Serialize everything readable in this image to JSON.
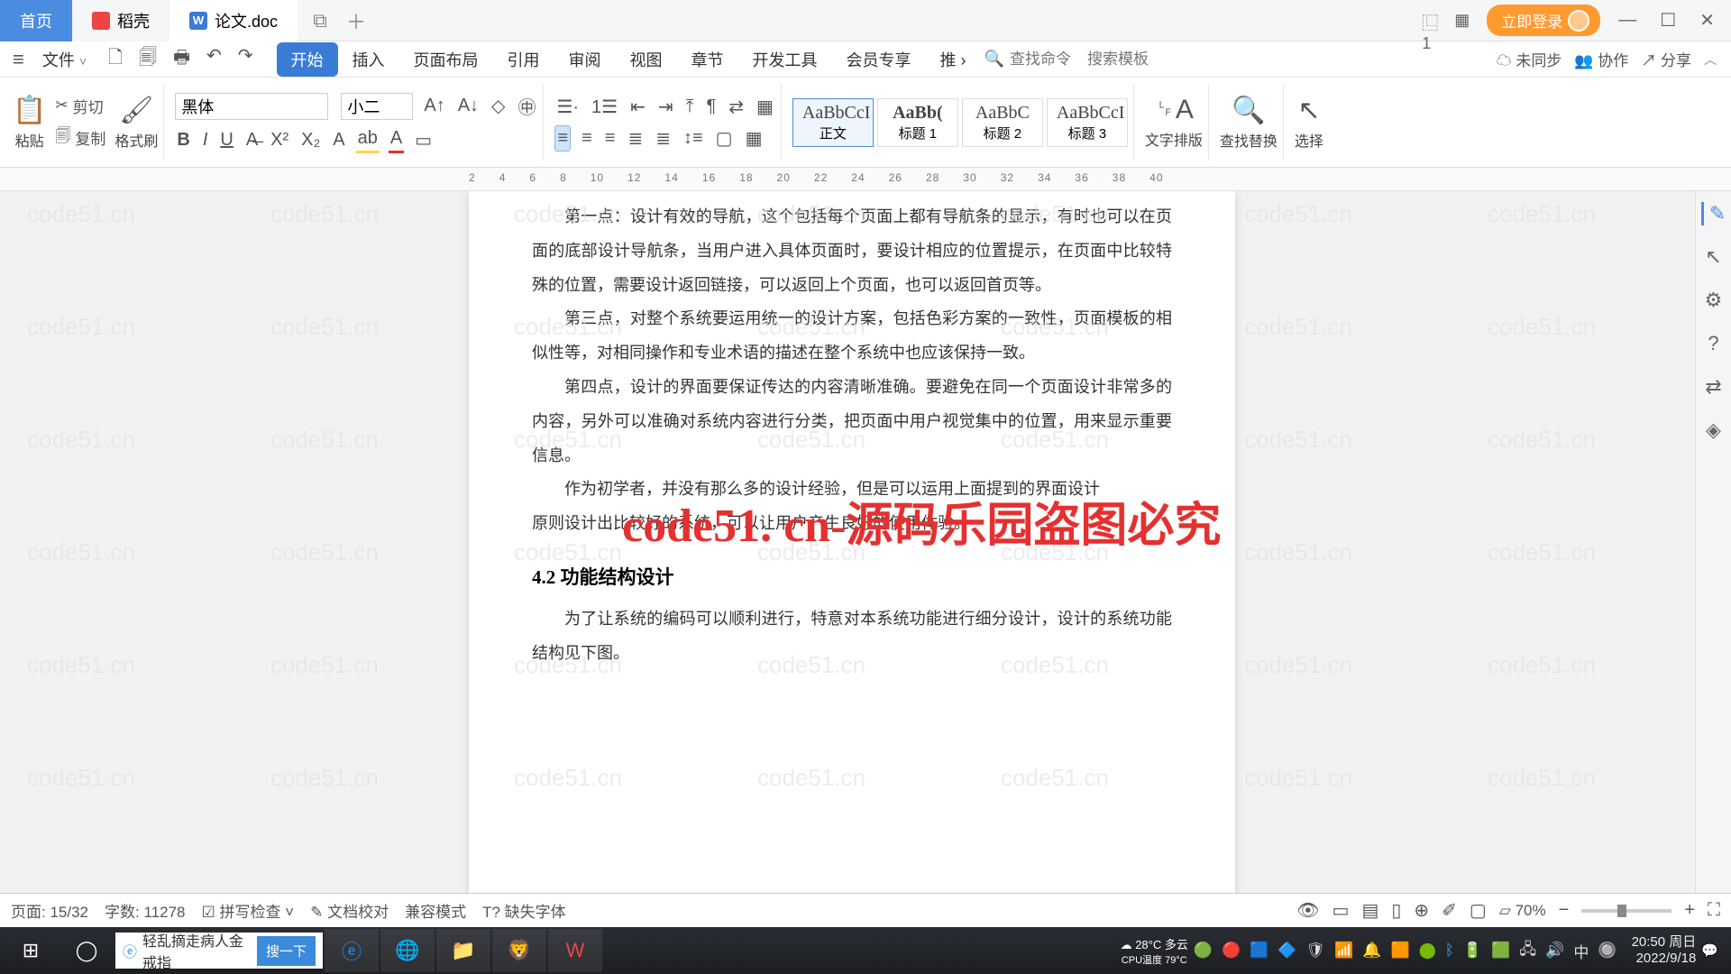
{
  "tabs": {
    "home": "首页",
    "docao": "稻壳",
    "doc": "论文.doc"
  },
  "title_right": {
    "login": "立即登录"
  },
  "menu": {
    "file": "文件",
    "ribbon": [
      "开始",
      "插入",
      "页面布局",
      "引用",
      "审阅",
      "视图",
      "章节",
      "开发工具",
      "会员专享",
      "推"
    ],
    "search_ph": "查找命令",
    "template_ph": "搜索模板",
    "unsync": "未同步",
    "collab": "协作",
    "share": "分享"
  },
  "ribbon": {
    "paste": "粘贴",
    "cut": "剪切",
    "copy": "复制",
    "fmt": "格式刷",
    "font": "黑体",
    "size": "小二",
    "styles": [
      {
        "prev": "AaBbCcI",
        "lbl": "正文"
      },
      {
        "prev": "AaBb(",
        "lbl": "标题 1"
      },
      {
        "prev": "AaBbC",
        "lbl": "标题 2"
      },
      {
        "prev": "AaBbCcI",
        "lbl": "标题 3"
      }
    ],
    "layout": "文字排版",
    "find": "查找替换",
    "select": "选择"
  },
  "ruler": [
    "2",
    "4",
    "6",
    "8",
    "10",
    "12",
    "14",
    "16",
    "18",
    "20",
    "22",
    "24",
    "26",
    "28",
    "30",
    "32",
    "34",
    "36",
    "38",
    "40"
  ],
  "doc": {
    "p1": "第一点：设计有效的导航，这个包括每个页面上都有导航条的显示，有时也可以在页面的底部设计导航条，当用户进入具体页面时，要设计相应的位置提示，在页面中比较特殊的位置，需要设计返回链接，可以返回上个页面，也可以返回首页等。",
    "p2": "第三点，对整个系统要运用统一的设计方案，包括色彩方案的一致性，页面模板的相似性等，对相同操作和专业术语的描述在整个系统中也应该保持一致。",
    "p3": "第四点，设计的界面要保证传达的内容清晰准确。要避免在同一个页面设计非常多的内容，另外可以准确对系统内容进行分类，把页面中用户视觉集中的位置，用来显示重要信息。",
    "p4a": "作为初学者，并没有那么多的设计经验，但是可以运用上面提到的界面设计",
    "p4b": "原则设计出比较好的系统，可以让用户产生良好的使用体验。",
    "h": "4.2 功能结构设计",
    "p5": "为了让系统的编码可以顺利进行，特意对本系统功能进行细分设计，设计的系统功能结构见下图。"
  },
  "watermark_text": "code51.cn",
  "watermark_big": "code51. cn-源码乐园盗图必究",
  "status": {
    "page_lbl": "页面:",
    "page_val": "15/32",
    "words_lbl": "字数:",
    "words_val": "11278",
    "spell": "拼写检查",
    "check": "文档校对",
    "compat": "兼容模式",
    "missing": "缺失字体",
    "zoom": "70%"
  },
  "taskbar": {
    "search_text": "轻乱摘走病人金戒指",
    "search_btn": "搜一下",
    "weather_temp": "28°C",
    "weather_sub": "多云",
    "cpu": "CPU温度",
    "cpu_val": "79°C",
    "time": "20:50",
    "day": "周日",
    "date": "2022/9/18",
    "lang": "中"
  }
}
